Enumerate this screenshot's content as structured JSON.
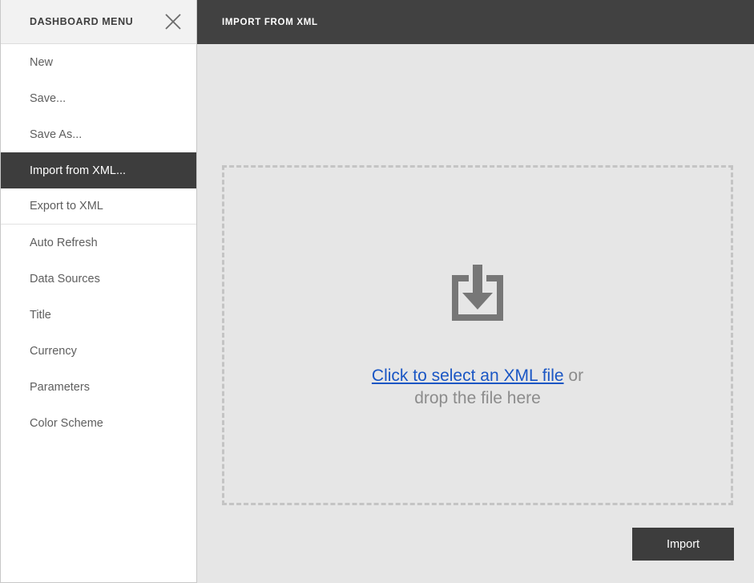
{
  "sidebar": {
    "title": "DASHBOARD MENU",
    "close_icon": "close-icon",
    "items": [
      {
        "label": "New",
        "selected": false,
        "sep_above": false,
        "sep_below": false
      },
      {
        "label": "Save...",
        "selected": false,
        "sep_above": false,
        "sep_below": false
      },
      {
        "label": "Save As...",
        "selected": false,
        "sep_above": false,
        "sep_below": false
      },
      {
        "label": "Import from XML...",
        "selected": true,
        "sep_above": false,
        "sep_below": false
      },
      {
        "label": "Export to XML",
        "selected": false,
        "sep_above": false,
        "sep_below": true
      },
      {
        "label": "Auto Refresh",
        "selected": false,
        "sep_above": false,
        "sep_below": false
      },
      {
        "label": "Data Sources",
        "selected": false,
        "sep_above": false,
        "sep_below": false
      },
      {
        "label": "Title",
        "selected": false,
        "sep_above": false,
        "sep_below": false
      },
      {
        "label": "Currency",
        "selected": false,
        "sep_above": false,
        "sep_below": false
      },
      {
        "label": "Parameters",
        "selected": false,
        "sep_above": false,
        "sep_below": false
      },
      {
        "label": "Color Scheme",
        "selected": false,
        "sep_above": false,
        "sep_below": false
      }
    ]
  },
  "main": {
    "header_title": "IMPORT FROM XML",
    "dropzone": {
      "icon": "download-tray-icon",
      "link_text": "Click to select an XML file",
      "text_after_link": " or",
      "second_line": "drop the file here"
    },
    "import_button_label": "Import"
  },
  "colors": {
    "header_bar": "#414141",
    "selected_item": "#3d3d3d",
    "page_background": "#e6e6e6",
    "sidebar_background": "#ffffff",
    "sidebar_header_background": "#f2f2f2",
    "link": "#1a56c4",
    "muted_text": "#8c8c8c",
    "dashed_border": "#c4c4c4"
  }
}
